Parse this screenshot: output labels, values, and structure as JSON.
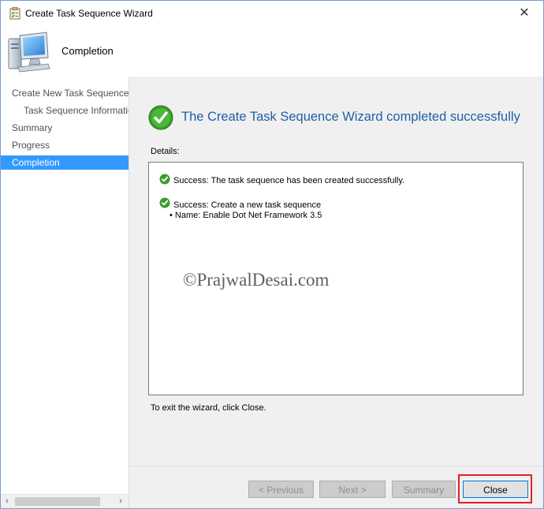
{
  "window": {
    "title": "Create Task Sequence Wizard",
    "close_glyph": "✕"
  },
  "header": {
    "title": "Completion",
    "icon": "computer-icon"
  },
  "nav": {
    "items": [
      {
        "label": "Create New Task Sequence",
        "level": "top",
        "active": false
      },
      {
        "label": "Task Sequence Informatic",
        "level": "sub",
        "active": false
      },
      {
        "label": "Summary",
        "level": "top",
        "active": false
      },
      {
        "label": "Progress",
        "level": "top",
        "active": false
      },
      {
        "label": "Completion",
        "level": "top",
        "active": true
      }
    ],
    "scroll_left": "‹",
    "scroll_right": "›"
  },
  "main": {
    "status_title": "The Create Task Sequence Wizard completed successfully",
    "details_label": "Details:",
    "details": {
      "line1": "Success: The task sequence has been created successfully.",
      "line2": "Success: Create a new task sequence",
      "line3": "• Name: Enable Dot Net Framework 3.5"
    },
    "watermark": "©PrajwalDesai.com",
    "exit_text": "To exit the wizard, click Close."
  },
  "buttons": {
    "previous": "< Previous",
    "next": "Next >",
    "summary": "Summary",
    "close": "Close"
  },
  "colors": {
    "accent": "#3399ff",
    "title_blue": "#1f5fa6",
    "success_green": "#3c9a2c",
    "highlight_red": "#e0202a"
  }
}
